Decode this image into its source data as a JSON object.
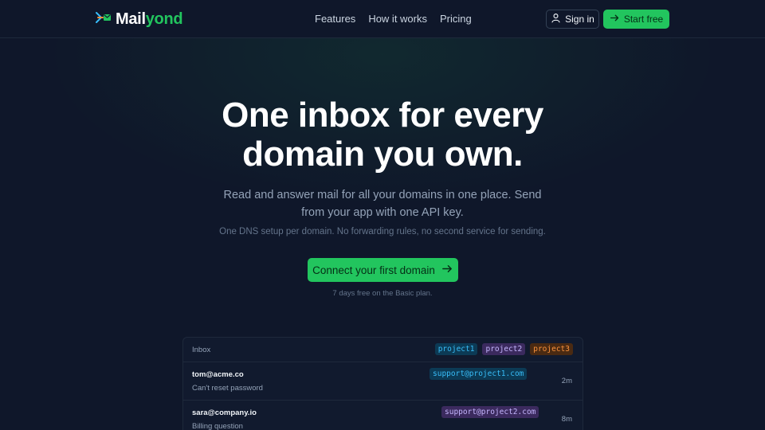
{
  "brand": {
    "name_part1": "Mail",
    "name_part2": "yond"
  },
  "nav": {
    "links": [
      "Features",
      "How it works",
      "Pricing"
    ],
    "signin_label": "Sign in",
    "start_label": "Start free"
  },
  "hero": {
    "title_line1": "One inbox for every",
    "title_line2": "domain you own.",
    "subtitle": "Read and answer mail for all your domains in one place. Send from your app with one API key.",
    "note": "One DNS setup per domain. No forwarding rules, no second service for sending.",
    "cta_label": "Connect your first domain",
    "trial": "7 days free on the Basic plan."
  },
  "inbox": {
    "title": "Inbox",
    "tags": [
      "project1",
      "project2",
      "project3"
    ],
    "messages": [
      {
        "from": "tom@acme.co",
        "to": "support@project1.com",
        "subject": "Can't reset password",
        "time": "2m"
      },
      {
        "from": "sara@company.io",
        "to": "support@project2.com",
        "subject": "Billing question",
        "time": "8m"
      }
    ]
  },
  "colors": {
    "background": "#0f172a",
    "accent": "#22c55e",
    "project1": "#38bdf8",
    "project2": "#c4b5fd",
    "project3": "#fb923c"
  }
}
